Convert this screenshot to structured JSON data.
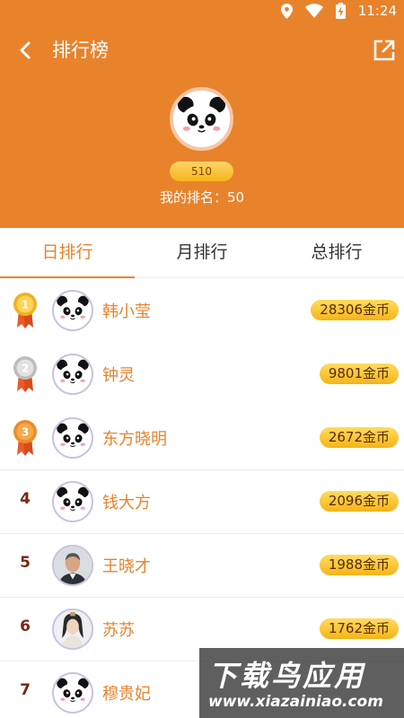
{
  "status_bar": {
    "time": "11:24",
    "icons": [
      "location-icon",
      "wifi-icon",
      "battery-charging-icon"
    ]
  },
  "nav": {
    "title": "排行榜",
    "back_icon": "back-arrow-icon",
    "share_icon": "share-icon"
  },
  "profile": {
    "avatar": "panda-avatar",
    "score": "510",
    "rank_text": "我的排名：50"
  },
  "tabs": [
    {
      "label": "日排行",
      "active": true
    },
    {
      "label": "月排行",
      "active": false
    },
    {
      "label": "总排行",
      "active": false
    }
  ],
  "leaderboard": [
    {
      "rank": "1",
      "medal": "gold",
      "name": "韩小莹",
      "coins": "28306金币",
      "avatar": "panda"
    },
    {
      "rank": "2",
      "medal": "silver",
      "name": "钟灵",
      "coins": "9801金币",
      "avatar": "panda"
    },
    {
      "rank": "3",
      "medal": "bronze",
      "name": "东方晓明",
      "coins": "2672金币",
      "avatar": "panda"
    },
    {
      "rank": "4",
      "medal": "",
      "name": "钱大方",
      "coins": "2096金币",
      "avatar": "panda"
    },
    {
      "rank": "5",
      "medal": "",
      "name": "王晓才",
      "coins": "1988金币",
      "avatar": "photo-man"
    },
    {
      "rank": "6",
      "medal": "",
      "name": "苏苏",
      "coins": "1762金币",
      "avatar": "photo-costume"
    },
    {
      "rank": "7",
      "medal": "",
      "name": "穆贵妃",
      "coins": "",
      "avatar": "panda"
    }
  ],
  "watermark": {
    "title": "下载鸟应用",
    "url": "www.xiazainiao.com"
  },
  "colors": {
    "brand": "#e8832c",
    "coin_pill": "#f4b418",
    "rank_text": "#7a2810",
    "gold": "#f2b01e",
    "silver": "#c8c8c8",
    "bronze": "#ee8a2a"
  }
}
